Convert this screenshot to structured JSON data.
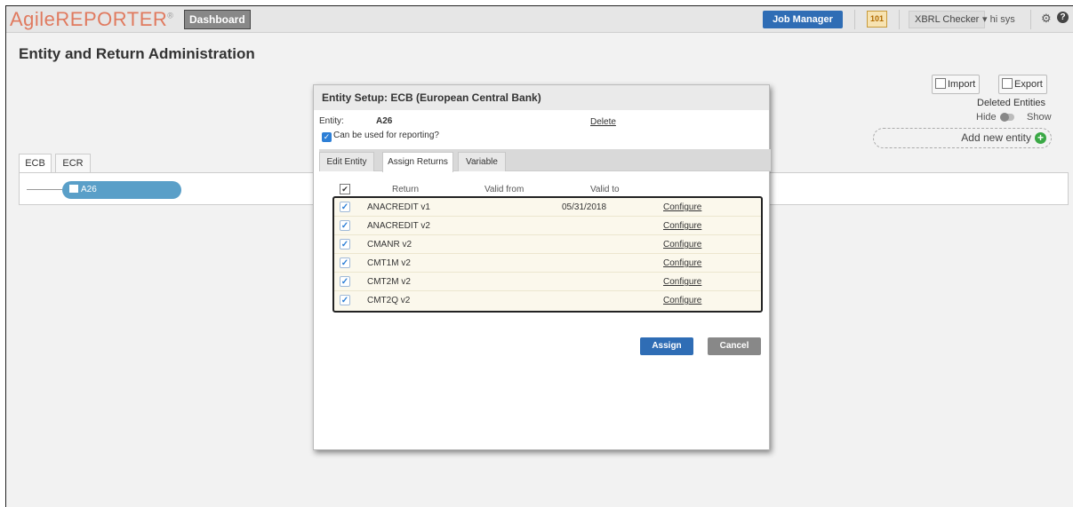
{
  "app": {
    "brand": "AgileREPORTER",
    "brand_mark": "®",
    "dashboard_label": "Dashboard",
    "job_manager_label": "Job Manager",
    "badge_101": "101",
    "xbrl_checker_label": "XBRL Checker",
    "user_label": "▾ hi sys",
    "settings_icon": "gear-icon",
    "help_icon": "help-icon",
    "accent": "#2f6db5",
    "brand_color": "#e07a5f"
  },
  "page": {
    "title": "Entity and Return Administration"
  },
  "right_panel": {
    "import_label": "Import",
    "export_label": "Export",
    "deleted_entities_label": "Deleted Entities",
    "hide_label": "Hide",
    "show_label": "Show",
    "add_entity_label": "Add new entity"
  },
  "entity_tabs": [
    {
      "label": "ECB"
    },
    {
      "label": "ECR"
    }
  ],
  "tree": {
    "node_label": "A26",
    "node_color": "#5a9fc8"
  },
  "dialog": {
    "title": "Entity Setup: ECB (European Central Bank)",
    "entity_label": "Entity:",
    "entity_value": "A26",
    "delete_label": "Delete",
    "can_report_label": "Can be used for reporting?",
    "tabs": [
      {
        "label": "Edit Entity"
      },
      {
        "label": "Assign Returns"
      },
      {
        "label": "Variable"
      }
    ],
    "columns": {
      "return": "Return",
      "valid_from": "Valid from",
      "valid_to": "Valid to"
    },
    "rows": [
      {
        "name": "ANACREDIT v1",
        "valid_from": "",
        "valid_to": "05/31/2018",
        "action": "Configure"
      },
      {
        "name": "ANACREDIT v2",
        "valid_from": "",
        "valid_to": "",
        "action": "Configure"
      },
      {
        "name": "CMANR v2",
        "valid_from": "",
        "valid_to": "",
        "action": "Configure"
      },
      {
        "name": "CMT1M v2",
        "valid_from": "",
        "valid_to": "",
        "action": "Configure"
      },
      {
        "name": "CMT2M v2",
        "valid_from": "",
        "valid_to": "",
        "action": "Configure"
      },
      {
        "name": "CMT2Q v2",
        "valid_from": "",
        "valid_to": "",
        "action": "Configure"
      }
    ],
    "assign_label": "Assign",
    "cancel_label": "Cancel"
  }
}
